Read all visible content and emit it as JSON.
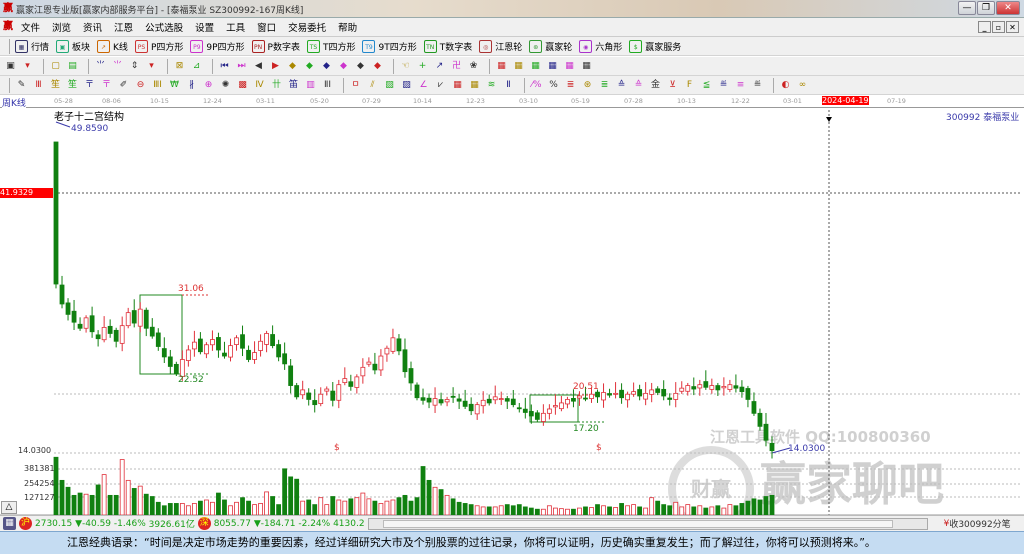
{
  "window": {
    "title": "赢家江恩专业版[赢家内部服务平台] - [泰福泵业  SZ300992-167周K线]",
    "min": "—",
    "restore": "❐",
    "close": "✕"
  },
  "menu": [
    "文件",
    "浏览",
    "资讯",
    "江恩",
    "公式选股",
    "设置",
    "工具",
    "窗口",
    "交易委托",
    "帮助"
  ],
  "mdi": {
    "min": "_",
    "restore": "▫",
    "close": "✕"
  },
  "toolbar1": [
    {
      "icon": "grid-icon",
      "g": "▦",
      "c": "#336",
      "label": "行情"
    },
    {
      "icon": "blocks-icon",
      "g": "▣",
      "c": "#2a7",
      "label": "板块"
    },
    {
      "icon": "kline-icon",
      "g": "↗",
      "c": "#c60",
      "label": "K线"
    },
    {
      "icon": "ps-icon",
      "g": "PS",
      "c": "#c33",
      "label": "P四方形"
    },
    {
      "icon": "p9-icon",
      "g": "P9",
      "c": "#c3c",
      "label": "9P四方形"
    },
    {
      "icon": "pn-icon",
      "g": "PN",
      "c": "#a22",
      "label": "P数字表"
    },
    {
      "icon": "ts-icon",
      "g": "TS",
      "c": "#2a2",
      "label": "T四方形"
    },
    {
      "icon": "t9-icon",
      "g": "T9",
      "c": "#28c",
      "label": "9T四方形"
    },
    {
      "icon": "tn-icon",
      "g": "TN",
      "c": "#292",
      "label": "T数字表"
    },
    {
      "icon": "gann-wheel-icon",
      "g": "◎",
      "c": "#a33",
      "label": "江恩轮"
    },
    {
      "icon": "winner-wheel-icon",
      "g": "⊛",
      "c": "#393",
      "label": "赢家轮"
    },
    {
      "icon": "hexagon-icon",
      "g": "◉",
      "c": "#a3c",
      "label": "六角形"
    },
    {
      "icon": "dollar-icon",
      "g": "$",
      "c": "#2a2",
      "label": "赢家服务"
    }
  ],
  "toolbar2": [
    "▣",
    "▾",
    "▢",
    "▤",
    "⺌",
    "⺌",
    "⇕",
    "▾",
    "⊠",
    "⊿",
    "⏮",
    "⏭",
    "◀",
    "▶",
    "◆",
    "◆",
    "◆",
    "◆",
    "◆",
    "◆",
    "☜",
    "+",
    "↗",
    "卍",
    "❀",
    "▦",
    "▦",
    "▦",
    "▦",
    "▦",
    "▦"
  ],
  "toolbar3": [
    "✎",
    "Ⅲ",
    "笙",
    "笙",
    "〒",
    "〒",
    "✐",
    "⊖",
    "ⅢⅠ",
    "₩",
    "∦",
    "⊕",
    "✺",
    "▩",
    "Ⅳ",
    "卄",
    "笛",
    "▥",
    "ⅡⅠ",
    "ㅁ",
    "⫽",
    "▨",
    "▨",
    "∠",
    "⩗",
    "▦",
    "▦",
    "≋",
    "Ⅱ",
    "⁄%",
    "%",
    "≣",
    "⊛",
    "≣",
    "≙",
    "≙",
    "金",
    "⊻",
    "F",
    "≦",
    "≝",
    "≡",
    "≝",
    "◐",
    "∞"
  ],
  "axis": {
    "dates": [
      "05-28",
      "08-06",
      "10-15",
      "12-24",
      "03-11",
      "05-20",
      "07-29",
      "10-14",
      "12-23",
      "03-10",
      "05-19",
      "07-28",
      "10-13",
      "12-22",
      "03-01",
      "2024-04-19",
      "07-19"
    ],
    "period": "周K线",
    "stock": "300992  泰福泵业",
    "cursor_price": "41.9329",
    "price_low_label": "14.0300",
    "vol_ticks": [
      "381381",
      "254254",
      "127127"
    ],
    "triangle": "△"
  },
  "annotations": {
    "title": "老子十二宫结构",
    "high": "49.8590",
    "low": "14.0300",
    "box1_high": "31.06",
    "box1_low": "22.52",
    "box2_high": "20.51",
    "box2_low": "17.20",
    "marker": "$"
  },
  "chart_data": {
    "type": "candlestick",
    "price_range": [
      14.03,
      49.859
    ],
    "first": {
      "open": 49.86,
      "close": 33.5,
      "high": 49.86,
      "low": 33.0
    },
    "closes": [
      33.5,
      31.2,
      30.0,
      29.1,
      28.4,
      29.6,
      28.0,
      27.2,
      28.5,
      27.8,
      26.9,
      28.7,
      30.2,
      29.0,
      30.6,
      28.4,
      27.5,
      26.3,
      25.1,
      24.0,
      23.2,
      24.8,
      25.9,
      26.8,
      25.7,
      26.5,
      27.1,
      25.9,
      25.2,
      26.4,
      27.3,
      26.1,
      24.8,
      25.6,
      26.9,
      27.8,
      26.4,
      25.1,
      24.3,
      21.8,
      20.5,
      21.3,
      20.2,
      19.6,
      20.8,
      21.4,
      20.1,
      21.9,
      22.6,
      21.7,
      22.8,
      23.9,
      24.5,
      23.6,
      25.2,
      26.1,
      27.3,
      25.8,
      23.4,
      22.1,
      20.4,
      20.1,
      19.9,
      20.3,
      19.8,
      20.2,
      20.5,
      20.0,
      19.4,
      18.9,
      19.6,
      20.1,
      19.8,
      20.5,
      20.3,
      20.0,
      19.6,
      19.2,
      18.7,
      18.3,
      17.9,
      18.6,
      19.1,
      19.5,
      19.8,
      20.2,
      20.0,
      20.6,
      20.3,
      20.8,
      20.5,
      21.0,
      20.7,
      20.9,
      20.4,
      20.8,
      21.1,
      20.6,
      20.9,
      21.3,
      21.0,
      20.6,
      20.2,
      20.9,
      21.5,
      21.8,
      21.4,
      21.9,
      21.6,
      21.8,
      21.3,
      21.7,
      21.9,
      21.5,
      21.1,
      20.2,
      18.6,
      17.1,
      15.5,
      14.3
    ],
    "volumes": [
      500,
      300,
      240,
      170,
      190,
      180,
      170,
      260,
      350,
      170,
      170,
      480,
      300,
      230,
      250,
      180,
      160,
      110,
      80,
      100,
      100,
      100,
      80,
      100,
      120,
      130,
      110,
      190,
      130,
      80,
      110,
      150,
      120,
      90,
      100,
      200,
      160,
      90,
      400,
      330,
      310,
      120,
      130,
      90,
      150,
      90,
      160,
      130,
      120,
      140,
      150,
      190,
      140,
      120,
      100,
      120,
      130,
      150,
      170,
      120,
      150,
      420,
      300,
      240,
      220,
      170,
      140,
      110,
      100,
      90,
      80,
      70,
      70,
      70,
      80,
      90,
      80,
      90,
      70,
      60,
      50,
      50,
      80,
      60,
      55,
      50,
      50,
      60,
      70,
      65,
      90,
      80,
      70,
      65,
      100,
      80,
      90,
      70,
      60,
      150,
      120,
      90,
      80,
      110,
      70,
      90,
      70,
      80,
      60,
      70,
      80,
      60,
      90,
      80,
      100,
      120,
      140,
      130,
      160,
      170
    ],
    "vol_axis": [
      127127,
      254254,
      381381
    ]
  },
  "status": {
    "sh_value": "2730.15",
    "sh_change": "▼-40.59",
    "sh_pct": "-1.46%",
    "sh_amount": "3926.61亿",
    "sz_value": "8055.77",
    "sz_change": "▼-184.71",
    "sz_pct": "-2.24%",
    "sz_amount": "4130.2",
    "right": "收300992分笔",
    "sh_icon": "沪",
    "sz_icon": "深"
  },
  "watermark": {
    "line1": "江恩工具软件  QQ:100800360",
    "line2": "赢家聊吧",
    "seal": "财赢"
  },
  "quote": "江恩经典语录：“时间是决定市场走势的重要因素，经过详细研究大市及个别股票的过往记录，你将可以证明，历史确实重复发生；而了解过往，你将可以预测将来。”。",
  "colors": {
    "up": "#e0303a",
    "down": "#108010",
    "label": "#3a3aaa",
    "cursor_bg": "#ff0000"
  }
}
